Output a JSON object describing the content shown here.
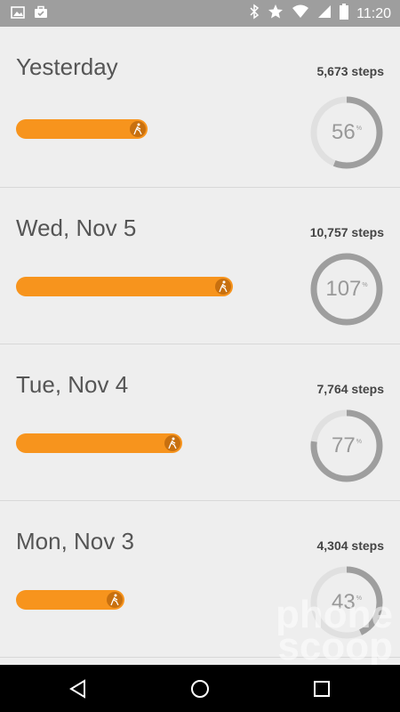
{
  "status_bar": {
    "time": "11:20",
    "left_icons": [
      "image-icon",
      "briefcase-icon"
    ],
    "right_icons": [
      "bluetooth-icon",
      "star-icon",
      "wifi-icon",
      "signal-icon",
      "battery-icon"
    ]
  },
  "days": [
    {
      "label": "Yesterday",
      "steps": "5,673 steps",
      "percent_text": "56",
      "percent_value": 56,
      "bar_fraction": 0.53
    },
    {
      "label": "Wed, Nov 5",
      "steps": "10,757 steps",
      "percent_text": "107",
      "percent_value": 107,
      "bar_fraction": 1.0
    },
    {
      "label": "Tue, Nov 4",
      "steps": "7,764 steps",
      "percent_text": "77",
      "percent_value": 77,
      "bar_fraction": 0.72
    },
    {
      "label": "Mon, Nov 3",
      "steps": "4,304 steps",
      "percent_text": "43",
      "percent_value": 43,
      "bar_fraction": 0.4
    }
  ],
  "percent_symbol": "%",
  "nav": {
    "items": [
      "back-icon",
      "home-icon",
      "recents-icon"
    ]
  },
  "watermark": {
    "line1": "phone",
    "line2": "scoop"
  },
  "colors": {
    "accent": "#f7941d",
    "ring_filled": "#9e9e9e",
    "ring_empty": "#e0e0e0"
  }
}
